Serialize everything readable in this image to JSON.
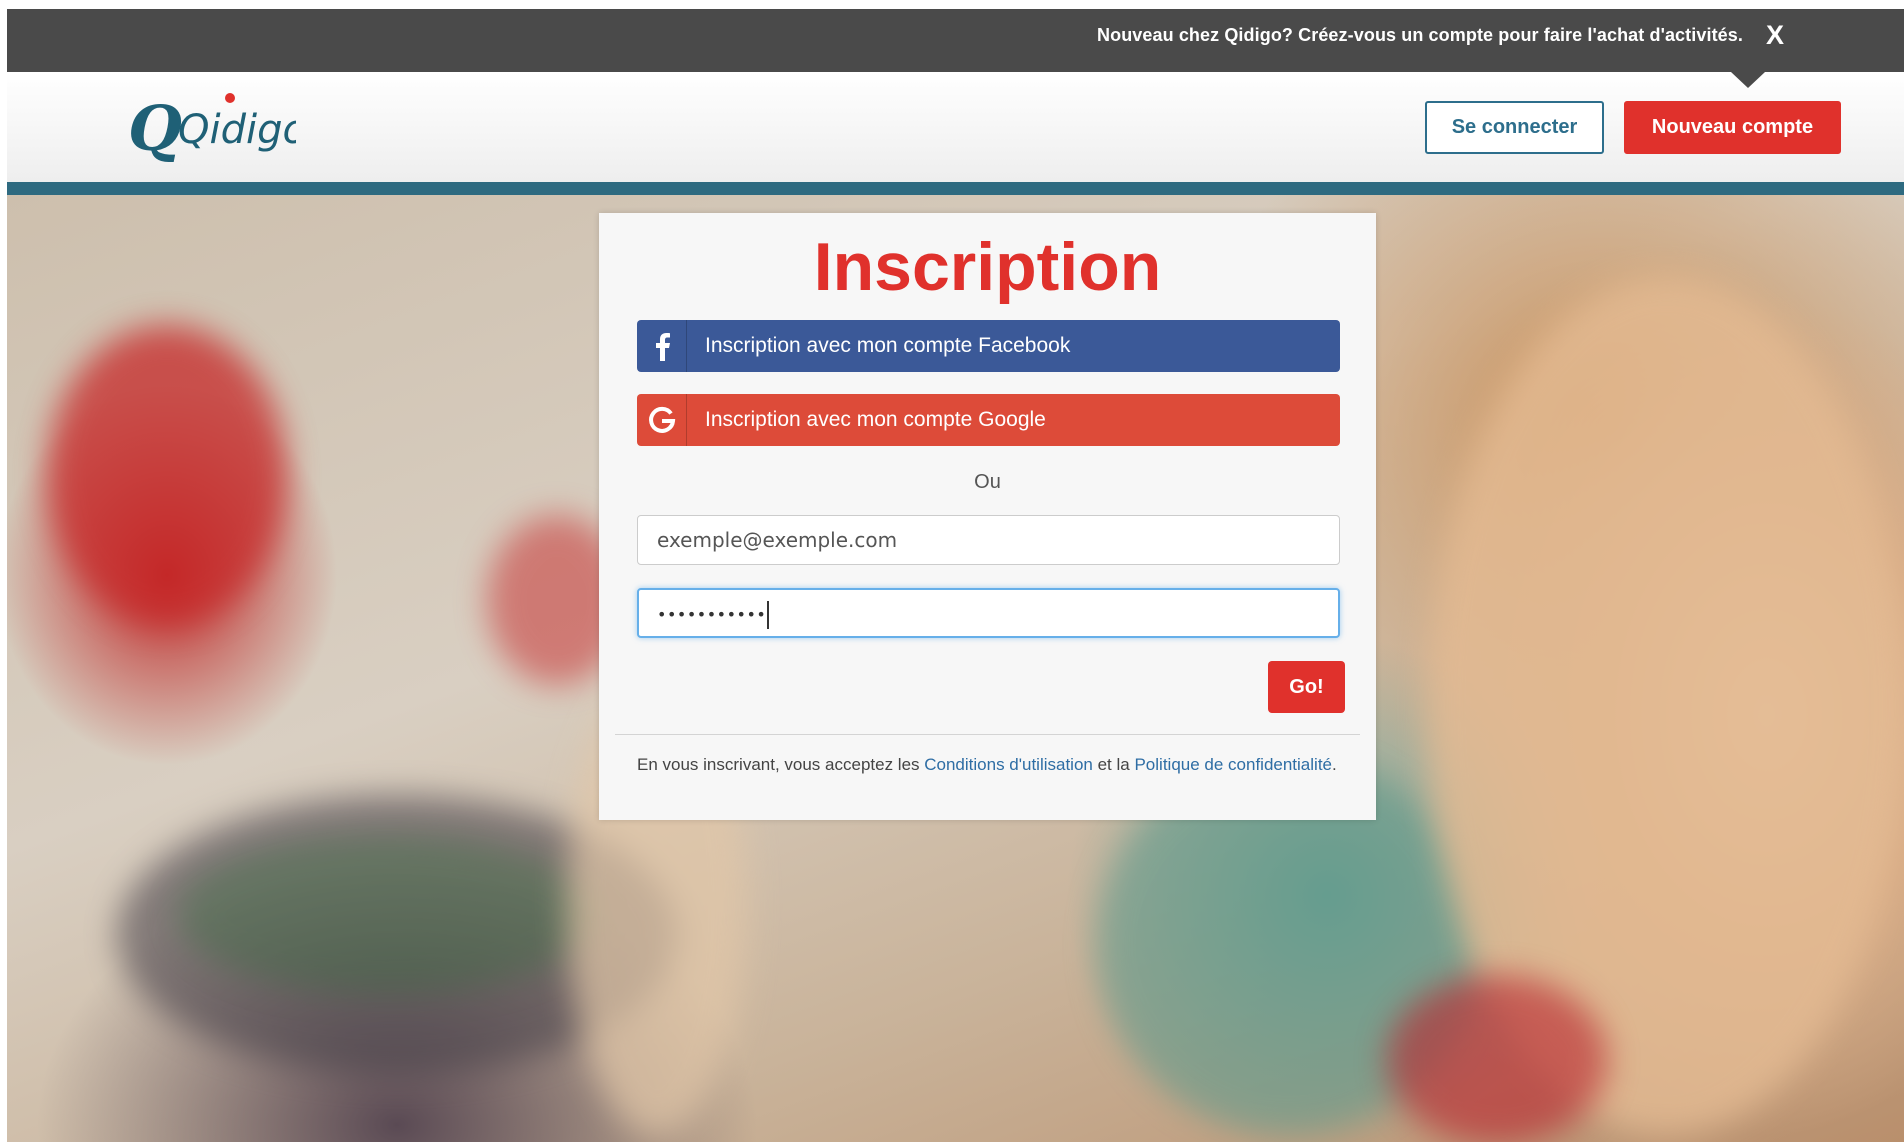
{
  "topbar": {
    "message": "Nouveau chez Qidigo? Créez-vous un compte pour faire l'achat d'activités.",
    "close_label": "X"
  },
  "header": {
    "logo_text": "Qidigo",
    "login_label": "Se connecter",
    "new_account_label": "Nouveau compte"
  },
  "signup": {
    "title": "Inscription",
    "facebook_label": "Inscription avec mon compte Facebook",
    "google_label": "Inscription avec mon compte Google",
    "or_label": "Ou",
    "email_placeholder": "exemple@exemple.com",
    "email_value": "",
    "password_masked": "•••••••••••",
    "submit_label": "Go!",
    "legal_prefix": "En vous inscrivant, vous acceptez les ",
    "terms_link": "Conditions d'utilisation",
    "legal_middle": " et la ",
    "privacy_link": "Politique de confidentialité",
    "legal_suffix": "."
  },
  "colors": {
    "accent_red": "#e0312c",
    "brand_teal": "#2d6e8c",
    "facebook_blue": "#3b5998",
    "google_red": "#dd4b39",
    "topbar_gray": "#4a4a4a"
  },
  "icons": {
    "facebook": "facebook-icon",
    "google": "google-icon",
    "close": "close-icon"
  }
}
